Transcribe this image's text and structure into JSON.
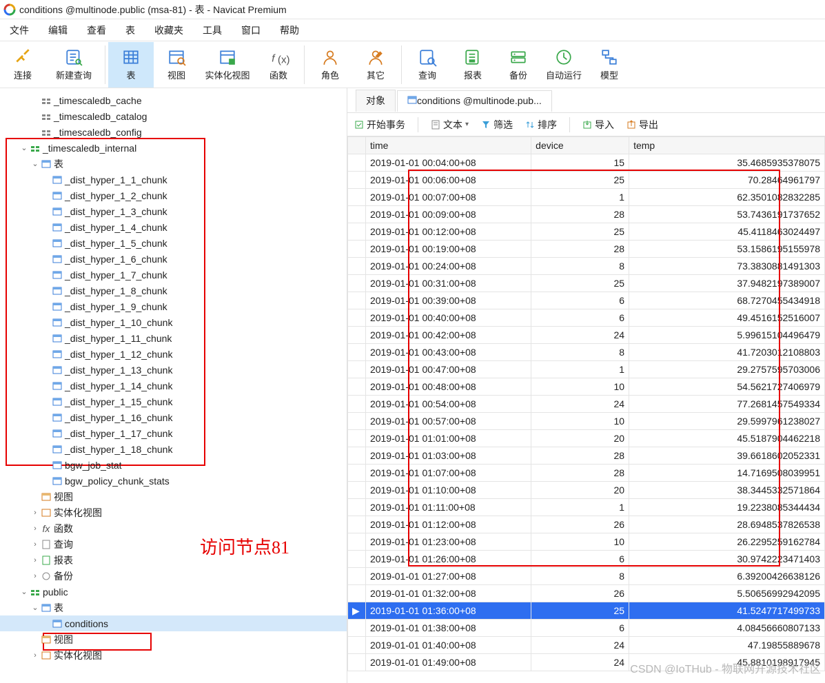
{
  "window": {
    "title": "conditions @multinode.public (msa-81) - 表 - Navicat Premium"
  },
  "menu": [
    "文件",
    "编辑",
    "查看",
    "表",
    "收藏夹",
    "工具",
    "窗口",
    "帮助"
  ],
  "toolbar": [
    {
      "id": "connect",
      "label": "连接"
    },
    {
      "id": "newquery",
      "label": "新建查询"
    },
    {
      "id": "table",
      "label": "表",
      "active": true
    },
    {
      "id": "view",
      "label": "视图"
    },
    {
      "id": "matview",
      "label": "实体化视图"
    },
    {
      "id": "func",
      "label": "函数"
    },
    {
      "id": "role",
      "label": "角色"
    },
    {
      "id": "other",
      "label": "其它"
    },
    {
      "id": "query",
      "label": "查询"
    },
    {
      "id": "report",
      "label": "报表"
    },
    {
      "id": "backup",
      "label": "备份"
    },
    {
      "id": "autorun",
      "label": "自动运行"
    },
    {
      "id": "model",
      "label": "模型"
    }
  ],
  "tree": {
    "schemas_top": [
      "_timescaledb_cache",
      "_timescaledb_catalog",
      "_timescaledb_config"
    ],
    "internal": "_timescaledb_internal",
    "tables_label": "表",
    "chunks": [
      "_dist_hyper_1_1_chunk",
      "_dist_hyper_1_2_chunk",
      "_dist_hyper_1_3_chunk",
      "_dist_hyper_1_4_chunk",
      "_dist_hyper_1_5_chunk",
      "_dist_hyper_1_6_chunk",
      "_dist_hyper_1_7_chunk",
      "_dist_hyper_1_8_chunk",
      "_dist_hyper_1_9_chunk",
      "_dist_hyper_1_10_chunk",
      "_dist_hyper_1_11_chunk",
      "_dist_hyper_1_12_chunk",
      "_dist_hyper_1_13_chunk",
      "_dist_hyper_1_14_chunk",
      "_dist_hyper_1_15_chunk",
      "_dist_hyper_1_16_chunk",
      "_dist_hyper_1_17_chunk",
      "_dist_hyper_1_18_chunk"
    ],
    "extra_tables": [
      "bgw_job_stat",
      "bgw_policy_chunk_stats"
    ],
    "view_label": "视图",
    "matview_label": "实体化视图",
    "func_label": "函数",
    "query_label": "查询",
    "report_label": "报表",
    "backup_label": "备份",
    "public": "public",
    "public_table": "conditions"
  },
  "annotation": "访问节点81",
  "tabs": {
    "obj": "对象",
    "data": "conditions @multinode.pub..."
  },
  "table_tb": {
    "begin": "开始事务",
    "text": "文本",
    "filter": "筛选",
    "sort": "排序",
    "import": "导入",
    "export": "导出"
  },
  "columns": [
    "time",
    "device",
    "temp"
  ],
  "rows": [
    [
      "2019-01-01 00:04:00+08",
      "15",
      "35.4685935378075"
    ],
    [
      "2019-01-01 00:06:00+08",
      "25",
      "70.28464961797"
    ],
    [
      "2019-01-01 00:07:00+08",
      "1",
      "62.3501082832285"
    ],
    [
      "2019-01-01 00:09:00+08",
      "28",
      "53.7436191737652"
    ],
    [
      "2019-01-01 00:12:00+08",
      "25",
      "45.4118463024497"
    ],
    [
      "2019-01-01 00:19:00+08",
      "28",
      "53.1586195155978"
    ],
    [
      "2019-01-01 00:24:00+08",
      "8",
      "73.3830881491303"
    ],
    [
      "2019-01-01 00:31:00+08",
      "25",
      "37.9482197389007"
    ],
    [
      "2019-01-01 00:39:00+08",
      "6",
      "68.7270455434918"
    ],
    [
      "2019-01-01 00:40:00+08",
      "6",
      "49.4516152516007"
    ],
    [
      "2019-01-01 00:42:00+08",
      "24",
      "5.99615104496479"
    ],
    [
      "2019-01-01 00:43:00+08",
      "8",
      "41.7203012108803"
    ],
    [
      "2019-01-01 00:47:00+08",
      "1",
      "29.2757595703006"
    ],
    [
      "2019-01-01 00:48:00+08",
      "10",
      "54.5621727406979"
    ],
    [
      "2019-01-01 00:54:00+08",
      "24",
      "77.2681457549334"
    ],
    [
      "2019-01-01 00:57:00+08",
      "10",
      "29.5997961238027"
    ],
    [
      "2019-01-01 01:01:00+08",
      "20",
      "45.5187904462218"
    ],
    [
      "2019-01-01 01:03:00+08",
      "28",
      "39.6618602052331"
    ],
    [
      "2019-01-01 01:07:00+08",
      "28",
      "14.7169508039951"
    ],
    [
      "2019-01-01 01:10:00+08",
      "20",
      "38.3445332571864"
    ],
    [
      "2019-01-01 01:11:00+08",
      "1",
      "19.2238085344434"
    ],
    [
      "2019-01-01 01:12:00+08",
      "26",
      "28.6948537826538"
    ],
    [
      "2019-01-01 01:23:00+08",
      "10",
      "26.2295259162784"
    ],
    [
      "2019-01-01 01:26:00+08",
      "6",
      "30.9742223471403"
    ],
    [
      "2019-01-01 01:27:00+08",
      "8",
      "6.39200426638126"
    ],
    [
      "2019-01-01 01:32:00+08",
      "26",
      "5.50656992942095"
    ],
    [
      "2019-01-01 01:36:00+08",
      "25",
      "41.5247717499733"
    ],
    [
      "2019-01-01 01:38:00+08",
      "6",
      "4.08456660807133"
    ],
    [
      "2019-01-01 01:40:00+08",
      "24",
      "47.19855889678"
    ],
    [
      "2019-01-01 01:49:00+08",
      "24",
      "45.8810198917945"
    ]
  ],
  "selected_row": 26,
  "watermark": "CSDN @IoTHub - 物联网开源技术社区"
}
